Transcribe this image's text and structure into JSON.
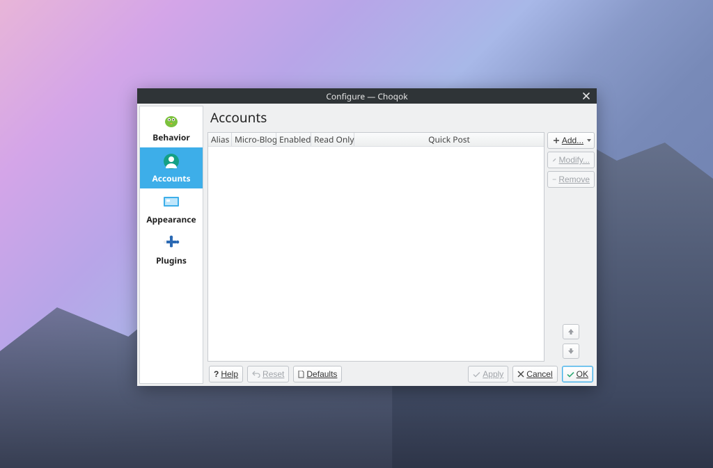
{
  "window": {
    "title": "Configure — Choqok"
  },
  "sidebar": {
    "items": [
      {
        "label": "Behavior",
        "icon": "bird-icon"
      },
      {
        "label": "Accounts",
        "icon": "user-icon"
      },
      {
        "label": "Appearance",
        "icon": "desktop-icon"
      },
      {
        "label": "Plugins",
        "icon": "plugin-icon"
      }
    ],
    "selected_index": 1
  },
  "page": {
    "title": "Accounts",
    "columns": [
      "Alias",
      "Micro-Blog",
      "Enabled",
      "Read Only",
      "Quick Post"
    ]
  },
  "right_buttons": {
    "add": "Add...",
    "modify": "Modify...",
    "remove": "Remove"
  },
  "footer": {
    "help": "Help",
    "reset": "Reset",
    "defaults": "Defaults",
    "apply": "Apply",
    "cancel": "Cancel",
    "ok": "OK"
  },
  "colors": {
    "accent": "#3daee9"
  }
}
